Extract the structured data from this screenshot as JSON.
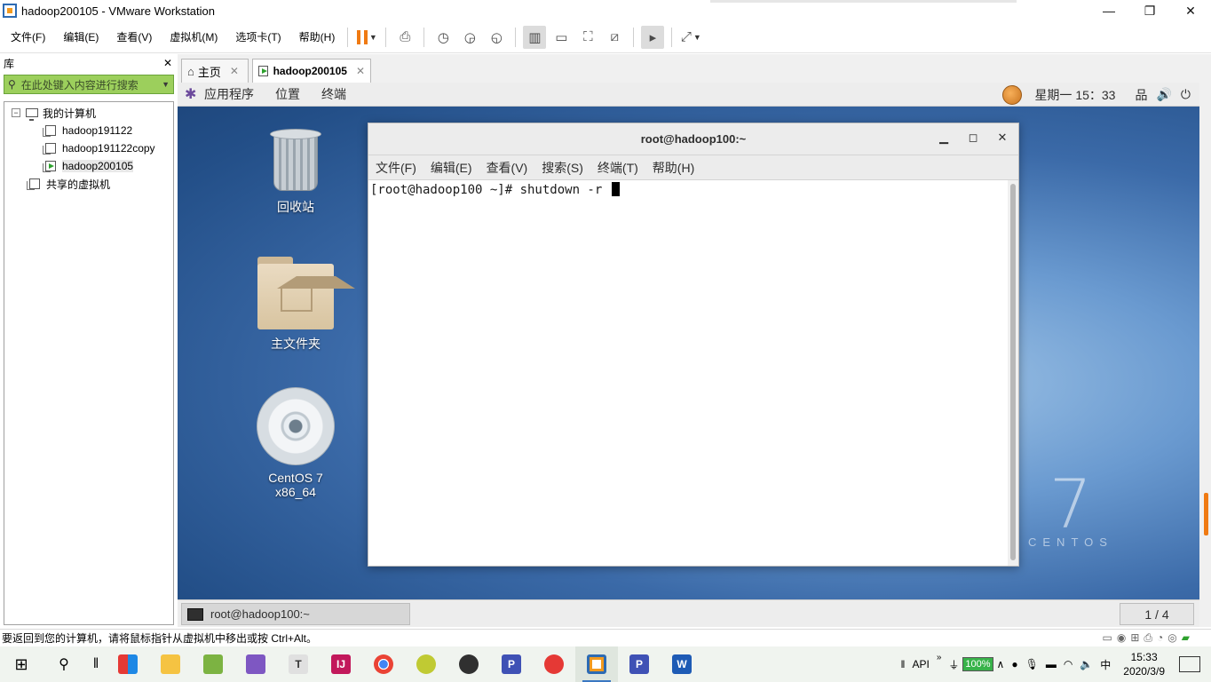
{
  "window": {
    "title": "hadoop200105 - VMware Workstation",
    "minimize": "—",
    "restore": "❐",
    "close": "✕"
  },
  "menubar": {
    "items": [
      "文件(F)",
      "编辑(E)",
      "查看(V)",
      "虚拟机(M)",
      "选项卡(T)",
      "帮助(H)"
    ],
    "toolbar_icons": [
      "pause-icon",
      "send-keys-icon",
      "snapshot-icon",
      "revert-snapshot-icon",
      "snapshot-manager-icon",
      "library-view-icon",
      "console-view-icon",
      "fullscreen-icon",
      "unity-icon",
      "terminal-icon",
      "stretch-icon"
    ],
    "accent": "#f07a12"
  },
  "library": {
    "title": "库",
    "close": "✕",
    "search_placeholder": "在此处键入内容进行搜索",
    "tree": {
      "root": "我的计算机",
      "expander": "−",
      "vms": [
        "hadoop191122",
        "hadoop191122copy",
        "hadoop200105"
      ],
      "shared": "共享的虚拟机"
    },
    "search_color": "#9ccf5c"
  },
  "tabs": [
    {
      "label": "主页",
      "close": "✕"
    },
    {
      "label": "hadoop200105",
      "close": "✕"
    }
  ],
  "guest": {
    "topbar": {
      "applications": "应用程序",
      "places": "位置",
      "terminal": "终端",
      "clock": "星期一 15：33",
      "network": "品",
      "volume": "🔊",
      "power": "⏻"
    },
    "desktop_icons": [
      "回收站",
      "主文件夹",
      "CentOS 7 x86_64"
    ],
    "brand": {
      "number": "7",
      "word": "CENTOS"
    },
    "terminal_window": {
      "title": "root@hadoop100:~",
      "min": "▁",
      "max": "◻",
      "close": "✕",
      "menu": [
        "文件(F)",
        "编辑(E)",
        "查看(V)",
        "搜索(S)",
        "终端(T)",
        "帮助(H)"
      ],
      "prompt": "[root@hadoop100 ~]# ",
      "command": "shutdown -r "
    },
    "taskbar": {
      "item": "root@hadoop100:~",
      "pager": "1 / 4"
    }
  },
  "statusbar": {
    "message": "要返回到您的计算机，请将鼠标指针从虚拟机中移出或按 Ctrl+Alt。"
  },
  "os_taskbar": {
    "apps": [
      "start-icon",
      "search-icon",
      "taskview-icon",
      "windows-app-icon",
      "file-explorer-icon",
      "notepad-icon",
      "feather-icon",
      "typora-icon",
      "intellij-icon",
      "chrome-icon",
      "music-icon",
      "obs-icon",
      "pycharm-p-icon",
      "snail-icon",
      "vmware-icon",
      "ppt-icon",
      "word-icon"
    ],
    "tray": {
      "api": "API",
      "chevrons": "»",
      "battery": "100%",
      "ime": "中",
      "time": "15:33",
      "date": "2020/3/9"
    }
  }
}
